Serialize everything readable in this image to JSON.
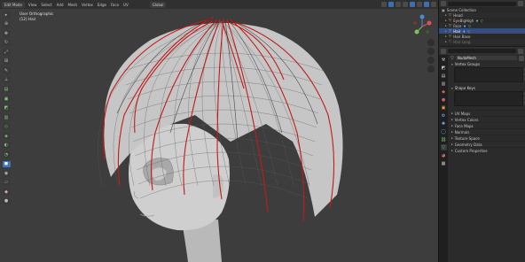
{
  "header": {
    "mode": "Edit Mode",
    "menus": [
      "View",
      "Select",
      "Add",
      "Mesh",
      "Vertex",
      "Edge",
      "Face",
      "UV"
    ],
    "transform": "Global"
  },
  "viewport": {
    "view_name": "User Orthographic",
    "object_label": "(12) Hair"
  },
  "outliner": {
    "rows": [
      {
        "label": "Scene Collection",
        "indent": 0,
        "kind": "collection"
      },
      {
        "label": "Head",
        "indent": 1,
        "kind": "object"
      },
      {
        "label": "EyeBigHigh",
        "indent": 1,
        "kind": "object"
      },
      {
        "label": "Face",
        "indent": 1,
        "kind": "object"
      },
      {
        "label": "Hair",
        "indent": 1,
        "kind": "object",
        "selected": true
      },
      {
        "label": "Hair Base",
        "indent": 1,
        "kind": "object"
      },
      {
        "label": "Hair Long",
        "indent": 1,
        "kind": "object",
        "dim": true
      }
    ]
  },
  "properties": {
    "object_name": "NudaMesh",
    "panels": {
      "vertex_groups": "Vertex Groups",
      "shape_keys": "Shape Keys"
    },
    "collapsed": [
      "UV Maps",
      "Vertex Colors",
      "Face Maps",
      "Normals",
      "Texture Space",
      "Geometry Data",
      "Custom Properties"
    ]
  },
  "colors": {
    "seam_red": "#c21a1a",
    "selected_blue": "#4772b3",
    "mesh_grey": "#c9c9c9"
  }
}
